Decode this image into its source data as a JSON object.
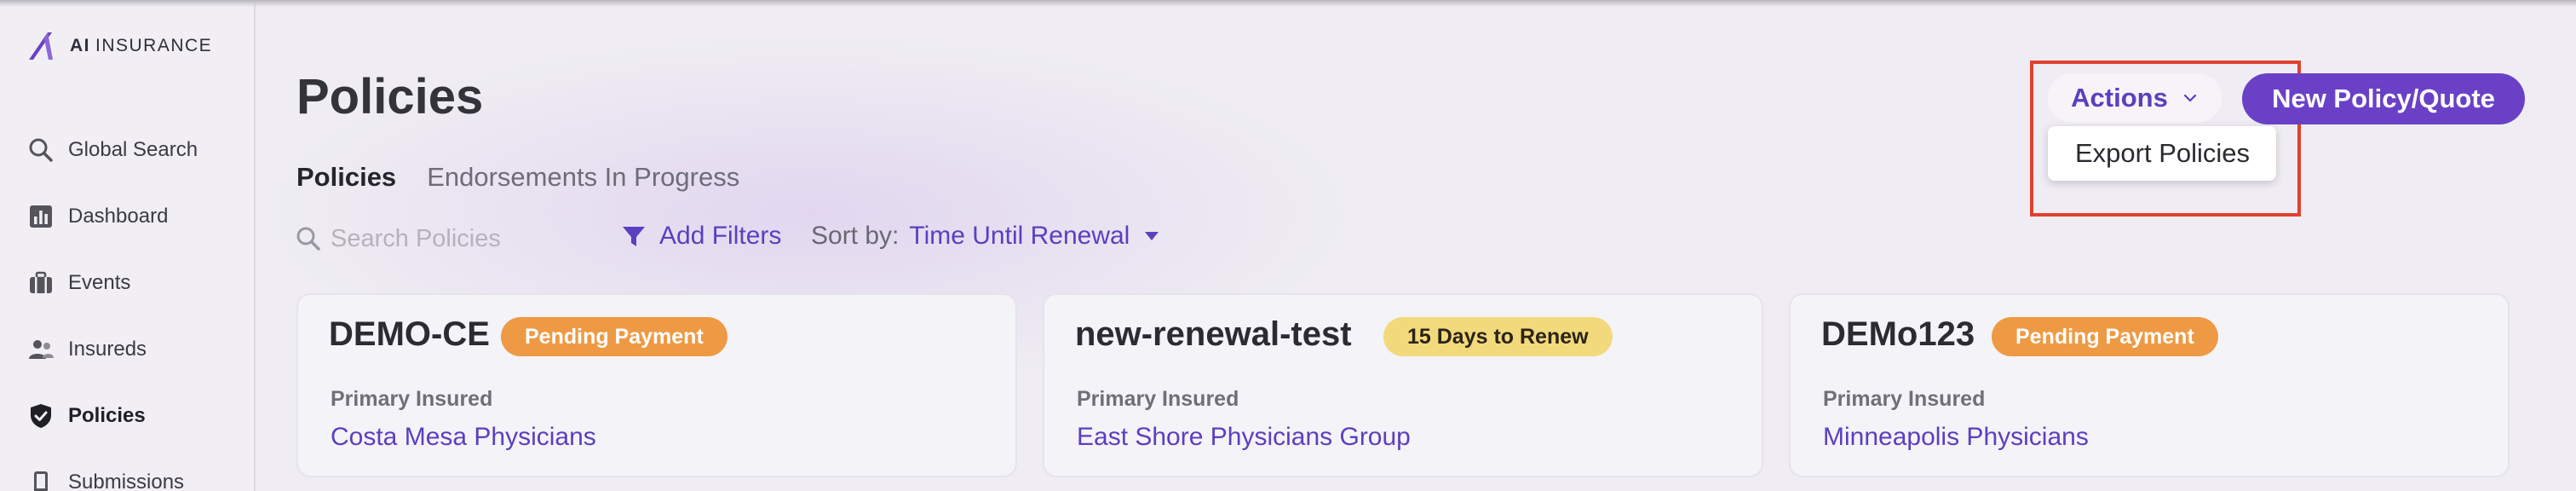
{
  "app": {
    "logo_bold": "AI",
    "logo_text": "INSURANCE"
  },
  "sidebar": {
    "items": [
      {
        "label": "Global Search",
        "icon": "search-icon"
      },
      {
        "label": "Dashboard",
        "icon": "bar-chart-icon"
      },
      {
        "label": "Events",
        "icon": "briefcase-icon"
      },
      {
        "label": "Insureds",
        "icon": "users-icon"
      },
      {
        "label": "Policies",
        "icon": "shield-check-icon",
        "active": true
      },
      {
        "label": "Submissions",
        "icon": "phone-icon"
      }
    ]
  },
  "header": {
    "title": "Policies",
    "actions_label": "Actions",
    "actions_menu": [
      "Export Policies"
    ],
    "new_button_label": "New Policy/Quote"
  },
  "tabs": [
    {
      "label": "Policies",
      "active": true
    },
    {
      "label": "Endorsements In Progress",
      "active": false
    }
  ],
  "toolbar": {
    "search_placeholder": "Search Policies",
    "filters_label": "Add Filters",
    "sort_label": "Sort by:",
    "sort_value": "Time Until Renewal"
  },
  "cards": [
    {
      "title": "DEMO-CE",
      "badge": "Pending Payment",
      "badge_style": "orange",
      "label": "Primary Insured",
      "value": "Costa Mesa Physicians"
    },
    {
      "title": "new-renewal-test",
      "badge": "15 Days to Renew",
      "badge_style": "yellow",
      "label": "Primary Insured",
      "value": "East Shore Physicians Group"
    },
    {
      "title": "DEMo123",
      "badge": "Pending Payment",
      "badge_style": "orange",
      "label": "Primary Insured",
      "value": "Minneapolis Physicians"
    }
  ],
  "colors": {
    "accent": "#5b3fbf",
    "primary_button": "#6a41c6",
    "badge_orange": "#ee9a44",
    "badge_yellow": "#f2d97c",
    "highlight": "#e0412f"
  }
}
